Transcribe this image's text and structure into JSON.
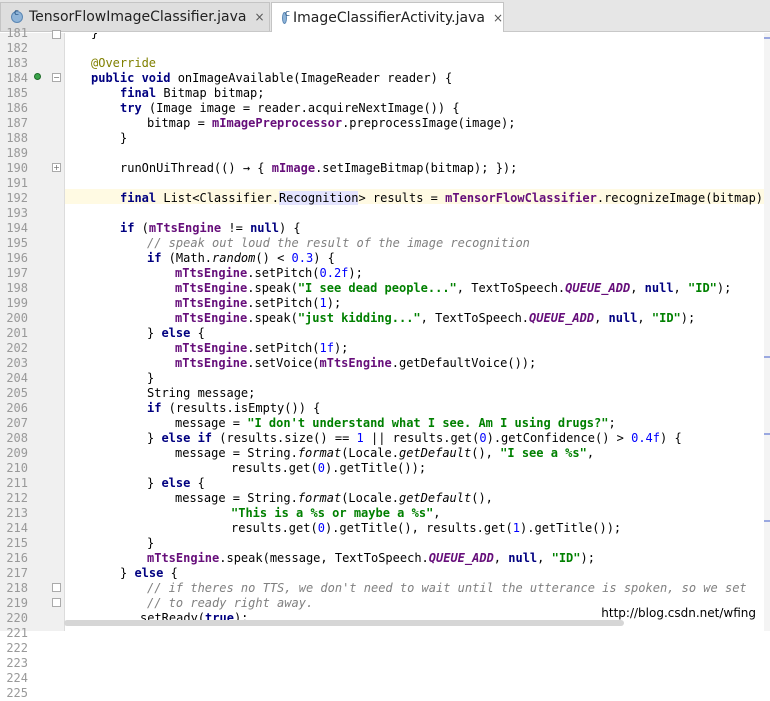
{
  "tabs": [
    {
      "label": "TensorFlowImageClassifier.java",
      "close": "×",
      "active": false
    },
    {
      "label": "ImageClassifierActivity.java",
      "close": "×",
      "active": true
    }
  ],
  "gutter": {
    "line_numbers": [
      "181",
      "182",
      "183",
      "184",
      "185",
      "186",
      "187",
      "188",
      "189",
      "190",
      "191",
      "192",
      "193",
      "194",
      "195",
      "196",
      "197",
      "198",
      "199",
      "200",
      "201",
      "202",
      "203",
      "204",
      "205",
      "206",
      "207",
      "208",
      "209",
      "210",
      "211",
      "212",
      "213",
      "214",
      "215",
      "216",
      "217",
      "218",
      "219",
      "220",
      "221",
      "222",
      "223",
      "224",
      "225"
    ]
  },
  "code": {
    "l181": "}",
    "l183_ann": "@Override",
    "l184_kw1": "public void",
    "l184_rest": " onImageAvailable(ImageReader reader) {",
    "l185_kw": "final",
    "l185_rest": " Bitmap bitmap;",
    "l186_kw": "try",
    "l186_rest": " (Image image = reader.acquireNextImage()) {",
    "l187_a": "bitmap = ",
    "l187_fld": "mImagePreprocessor",
    "l187_b": ".preprocessImage(image);",
    "l188": "}",
    "l190_a": "runOnUiThread(() → { ",
    "l190_fld": "mImage",
    "l190_b": ".setImageBitmap(bitmap); });",
    "l192_kw": "final",
    "l192_a": " List<Classifier.",
    "l192_ref": "Recognition",
    "l192_b": "> results = ",
    "l192_fld": "mTensorFlowClassifier",
    "l192_c": ".recognizeImage(bitmap);",
    "l194_kw1": "if",
    "l194_a": " (",
    "l194_fld": "mTtsEngine",
    "l194_b": " != ",
    "l194_kw2": "null",
    "l194_c": ") {",
    "l195_cmt": "// speak out loud the result of the image recognition",
    "l196_kw": "if",
    "l196_a": " (Math.",
    "l196_it": "random",
    "l196_b": "() < ",
    "l196_num": "0.3",
    "l196_c": ") {",
    "l197_fld": "mTtsEngine",
    "l197_a": ".setPitch(",
    "l197_num": "0.2f",
    "l197_b": ");",
    "l198_fld": "mTtsEngine",
    "l198_a": ".speak(",
    "l198_str": "\"I see dead people...\"",
    "l198_b": ", TextToSpeech.",
    "l198_sf": "QUEUE_ADD",
    "l198_c": ", ",
    "l198_kw": "null",
    "l198_d": ", ",
    "l198_str2": "\"ID\"",
    "l198_e": ");",
    "l199_fld": "mTtsEngine",
    "l199_a": ".setPitch(",
    "l199_num": "1",
    "l199_b": ");",
    "l200_fld": "mTtsEngine",
    "l200_a": ".speak(",
    "l200_str": "\"just kidding...\"",
    "l200_b": ", TextToSpeech.",
    "l200_sf": "QUEUE_ADD",
    "l200_c": ", ",
    "l200_kw": "null",
    "l200_d": ", ",
    "l200_str2": "\"ID\"",
    "l200_e": ");",
    "l201_a": "} ",
    "l201_kw": "else",
    "l201_b": " {",
    "l202_fld": "mTtsEngine",
    "l202_a": ".setPitch(",
    "l202_num": "1f",
    "l202_b": ");",
    "l203_fld": "mTtsEngine",
    "l203_a": ".setVoice(",
    "l203_fld2": "mTtsEngine",
    "l203_b": ".getDefaultVoice());",
    "l204": "}",
    "l205": "String message;",
    "l206_kw": "if",
    "l206_a": " (results.isEmpty()) {",
    "l207_a": "message = ",
    "l207_str": "\"I don't understand what I see. Am I using drugs?\"",
    "l207_b": ";",
    "l208_a": "} ",
    "l208_kw": "else if",
    "l208_b": " (results.size() == ",
    "l208_n1": "1",
    "l208_c": " || results.get(",
    "l208_n2": "0",
    "l208_d": ").getConfidence() > ",
    "l208_n3": "0.4f",
    "l208_e": ") {",
    "l209_a": "message = String.",
    "l209_it": "format",
    "l209_b": "(Locale.",
    "l209_it2": "getDefault",
    "l209_c": "(), ",
    "l209_str": "\"I see a %s\"",
    "l209_d": ",",
    "l210_a": "results.get(",
    "l210_n": "0",
    "l210_b": ").getTitle());",
    "l211_a": "} ",
    "l211_kw": "else",
    "l211_b": " {",
    "l212_a": "message = String.",
    "l212_it": "format",
    "l212_b": "(Locale.",
    "l212_it2": "getDefault",
    "l212_c": "(),",
    "l213_str": "\"This is a %s or maybe a %s\"",
    "l213_a": ",",
    "l214_a": "results.get(",
    "l214_n1": "0",
    "l214_b": ").getTitle(), results.get(",
    "l214_n2": "1",
    "l214_c": ").getTitle());",
    "l215": "}",
    "l216_fld": "mTtsEngine",
    "l216_a": ".speak(message, TextToSpeech.",
    "l216_sf": "QUEUE_ADD",
    "l216_b": ", ",
    "l216_kw": "null",
    "l216_c": ", ",
    "l216_str": "\"ID\"",
    "l216_d": ");",
    "l217_a": "} ",
    "l217_kw": "else",
    "l217_b": " {",
    "l218_cmt": "// if theres no TTS, we don't need to wait until the utterance is spoken, so we set",
    "l219_cmt": "// to ready right away.",
    "l220_a": "setReady(",
    "l220_kw": "true",
    "l220_b": ");"
  },
  "watermark": "http://blog.csdn.net/wfing"
}
